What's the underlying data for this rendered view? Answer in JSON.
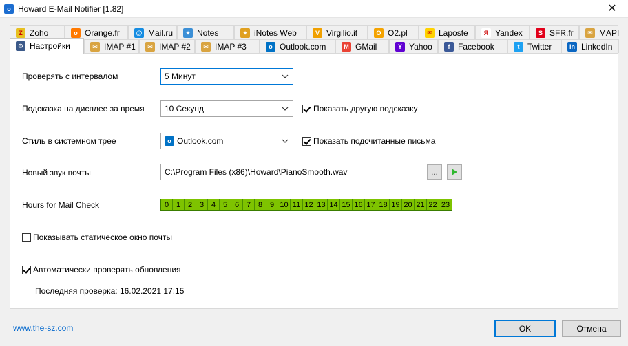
{
  "window": {
    "title": "Howard E-Mail Notifier [1.82]",
    "app_icon": "o",
    "close": "✕"
  },
  "tabs_row1": [
    {
      "label": "Zoho",
      "icon": "zoho-icon",
      "color": "#e8c020",
      "glyph": "Z"
    },
    {
      "label": "Orange.fr",
      "icon": "orange-icon",
      "color": "#ff7900",
      "glyph": "o"
    },
    {
      "label": "Mail.ru",
      "icon": "mailru-icon",
      "color": "#168de2",
      "glyph": "@"
    },
    {
      "label": "Notes",
      "icon": "notes-icon",
      "color": "#3b8fd6",
      "glyph": "✦"
    },
    {
      "label": "iNotes Web",
      "icon": "inotes-icon",
      "color": "#e0a020",
      "glyph": "✦"
    },
    {
      "label": "Virgilio.it",
      "icon": "virgilio-icon",
      "color": "#f0a000",
      "glyph": "V"
    },
    {
      "label": "O2.pl",
      "icon": "o2-icon",
      "color": "#f4a300",
      "glyph": "O"
    },
    {
      "label": "Laposte",
      "icon": "laposte-icon",
      "color": "#ffd200",
      "glyph": "✉"
    },
    {
      "label": "Yandex",
      "icon": "yandex-icon",
      "color": "#ffffff",
      "glyph": "Я"
    },
    {
      "label": "SFR.fr",
      "icon": "sfr-icon",
      "color": "#e2001a",
      "glyph": "S"
    },
    {
      "label": "MAPI",
      "icon": "mapi-icon",
      "color": "#d9a441",
      "glyph": "✉"
    }
  ],
  "tabs_row2": [
    {
      "label": "Настройки",
      "icon": "settings-icon",
      "color": "#3c5a8a",
      "glyph": "⚙",
      "active": true
    },
    {
      "label": "IMAP #1",
      "icon": "imap-icon",
      "color": "#d9a441",
      "glyph": "✉"
    },
    {
      "label": "IMAP #2",
      "icon": "imap-icon",
      "color": "#d9a441",
      "glyph": "✉"
    },
    {
      "label": "IMAP #3",
      "icon": "imap-icon",
      "color": "#d9a441",
      "glyph": "✉"
    },
    {
      "label": "Outlook.com",
      "icon": "outlook-icon",
      "color": "#0072c6",
      "glyph": "o"
    },
    {
      "label": "GMail",
      "icon": "gmail-icon",
      "color": "#ea4335",
      "glyph": "M"
    },
    {
      "label": "Yahoo",
      "icon": "yahoo-icon",
      "color": "#6001d2",
      "glyph": "Y"
    },
    {
      "label": "Facebook",
      "icon": "facebook-icon",
      "color": "#3b5998",
      "glyph": "f"
    },
    {
      "label": "Twitter",
      "icon": "twitter-icon",
      "color": "#1da1f2",
      "glyph": "t"
    },
    {
      "label": "LinkedIn",
      "icon": "linkedin-icon",
      "color": "#0a66c2",
      "glyph": "in"
    }
  ],
  "settings": {
    "interval_label": "Проверять с интервалом",
    "interval_value": "5 Минут",
    "tooltip_label": "Подсказка на дисплее за время",
    "tooltip_value": "10 Секунд",
    "show_other_tooltip": "Показать другую подсказку",
    "tray_label": "Стиль в системном трее",
    "tray_value": "Outlook.com",
    "show_counted": "Показать подсчитанные письма",
    "sound_label": "Новый звук почты",
    "sound_path": "C:\\Program Files (x86)\\Howard\\PianoSmooth.wav",
    "browse_label": "...",
    "hours_label": "Hours for Mail Check",
    "hours": [
      "0",
      "1",
      "2",
      "3",
      "4",
      "5",
      "6",
      "7",
      "8",
      "9",
      "10",
      "11",
      "12",
      "13",
      "14",
      "15",
      "16",
      "17",
      "18",
      "19",
      "20",
      "21",
      "22",
      "23"
    ],
    "static_window": "Показывать статическое окно почты",
    "auto_update": "Автоматически проверять обновления",
    "last_check": "Последняя проверка: 16.02.2021 17:15"
  },
  "footer": {
    "link": "www.the-sz.com",
    "ok": "OK",
    "cancel": "Отмена"
  }
}
